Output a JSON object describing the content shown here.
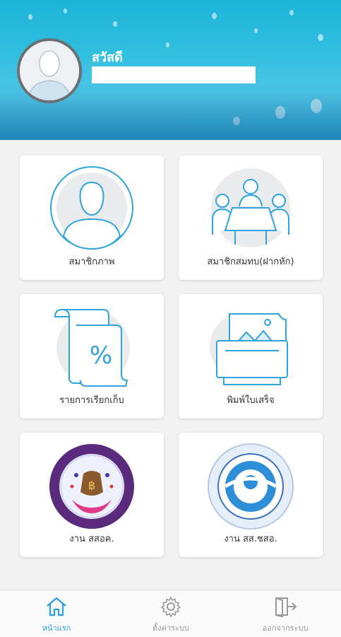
{
  "header": {
    "greeting": "สวัสดี",
    "user_name": ""
  },
  "menu": [
    {
      "label": "สมาชิกภาพ",
      "icon": "member-icon"
    },
    {
      "label": "สมาชิกสมทบ(ฝากหัก)",
      "icon": "meeting-icon"
    },
    {
      "label": "รายการเรียกเก็บ",
      "icon": "percent-document-icon"
    },
    {
      "label": "พิมพ์ใบเสร็จ",
      "icon": "printer-icon"
    },
    {
      "label": "งาน สสอค.",
      "icon": "cooperative-seal-icon"
    },
    {
      "label": "งาน สส.ชสอ.",
      "icon": "federation-seal-icon"
    }
  ],
  "nav": {
    "home": "หน้าแรก",
    "settings": "ตั้งค่าระบบ",
    "logout": "ออกจากระบบ"
  },
  "colors": {
    "accent": "#2b9fd9",
    "header": "#33bfe0",
    "icon_line": "#2ea3dc"
  }
}
